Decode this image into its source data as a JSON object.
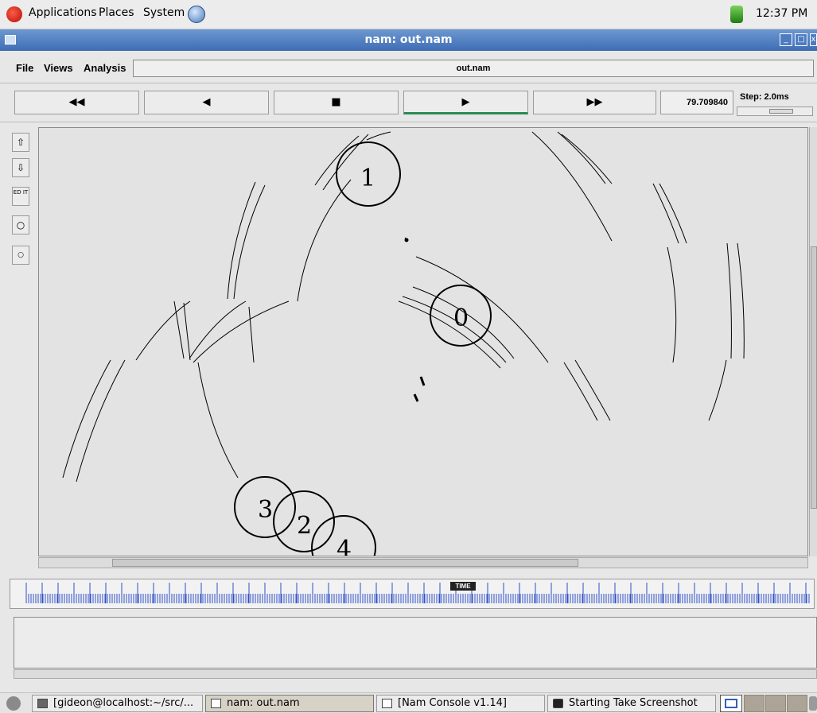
{
  "top_panel": {
    "menus": [
      "Applications",
      "Places",
      "System"
    ],
    "clock": "12:37 PM"
  },
  "window": {
    "title": "nam: out.nam"
  },
  "menubar": {
    "items": [
      "File",
      "Views",
      "Analysis"
    ],
    "file_label": "out.nam"
  },
  "controls": {
    "buttons": [
      {
        "name": "rewind",
        "glyph": "◀◀"
      },
      {
        "name": "step-back",
        "glyph": "◀"
      },
      {
        "name": "stop",
        "glyph": "■"
      },
      {
        "name": "play",
        "glyph": "▶"
      },
      {
        "name": "fast-forward",
        "glyph": "▶▶"
      }
    ],
    "active": "play",
    "time": "79.709840",
    "step": "Step: 2.0ms"
  },
  "toolbar": {
    "edit_label": "ED IT"
  },
  "nodes": [
    {
      "id": "1"
    },
    {
      "id": "0"
    },
    {
      "id": "3"
    },
    {
      "id": "2"
    },
    {
      "id": "4"
    }
  ],
  "timeline": {
    "marker_label": "TIME"
  },
  "taskbar": {
    "items": [
      {
        "label": "[gideon@localhost:~/src/..."
      },
      {
        "label": "nam: out.nam"
      },
      {
        "label": "[Nam Console v1.14]"
      },
      {
        "label": "Starting Take Screenshot"
      }
    ]
  },
  "colors": {
    "titlebar": "#4f7cc1",
    "canvas": "#e3e3e3",
    "timeline_tick": "#3050c8",
    "active_play": "#2d8a54"
  }
}
